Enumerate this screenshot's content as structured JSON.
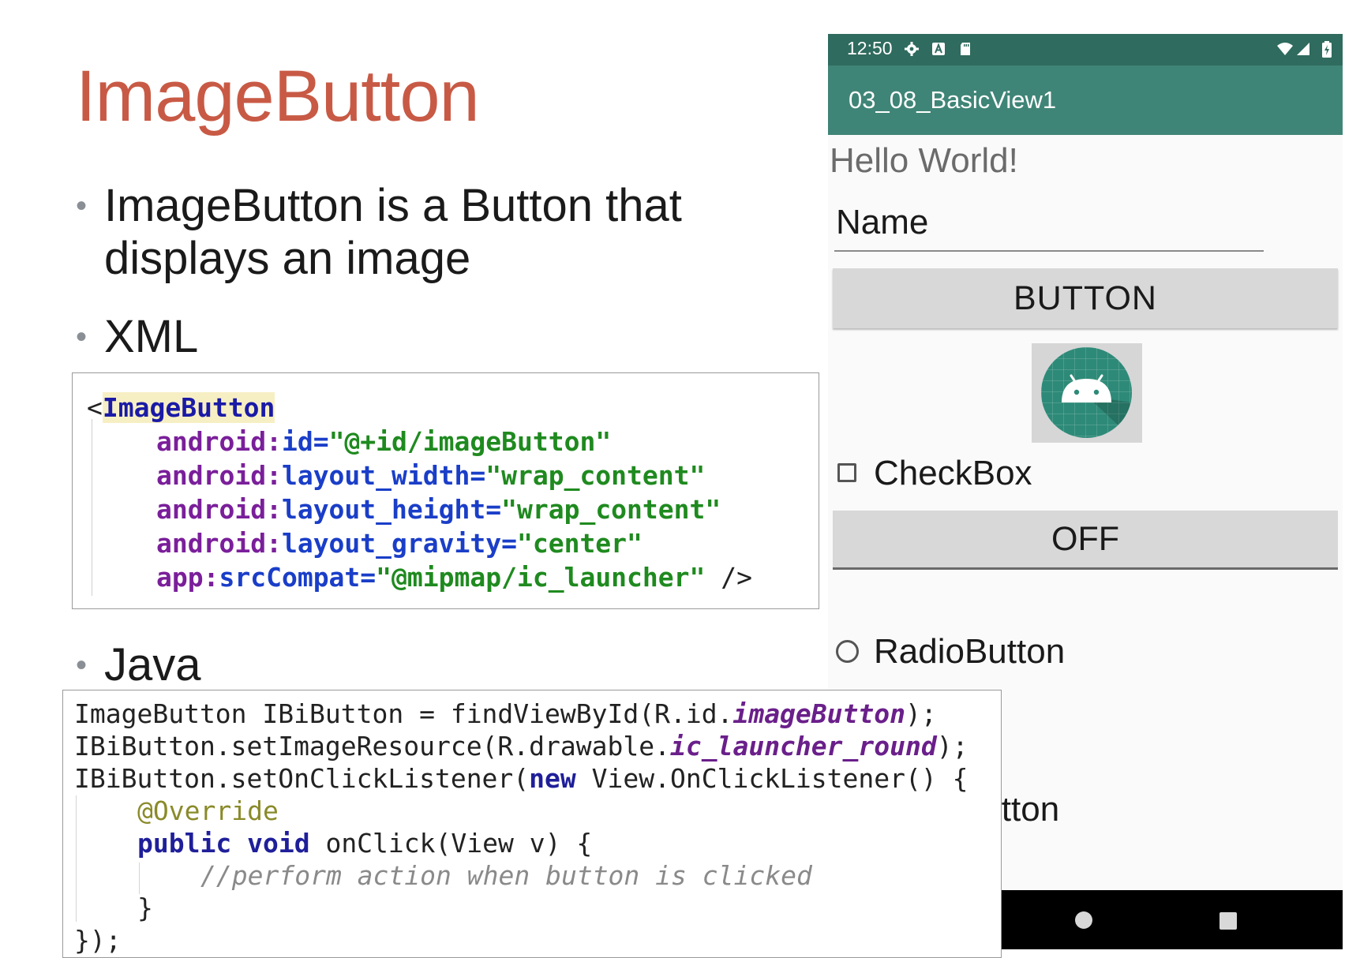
{
  "slide": {
    "title": "ImageButton",
    "bullets": {
      "b1_line1": "ImageButton is a Button that",
      "b1_line2": "displays an image",
      "b2": "XML",
      "b3": "Java",
      "marker": "•"
    }
  },
  "xml_code": {
    "open": "<",
    "tag": "ImageButton",
    "lines": [
      {
        "ns": "android:",
        "name": "id=",
        "value": "\"@+id/imageButton\"",
        "tail": ""
      },
      {
        "ns": "android:",
        "name": "layout_width=",
        "value": "\"wrap_content\"",
        "tail": ""
      },
      {
        "ns": "android:",
        "name": "layout_height=",
        "value": "\"wrap_content\"",
        "tail": ""
      },
      {
        "ns": "android:",
        "name": "layout_gravity=",
        "value": "\"center\"",
        "tail": ""
      },
      {
        "ns": "app:",
        "name": "srcCompat=",
        "value": "\"@mipmap/ic_launcher\"",
        "tail": " />"
      }
    ]
  },
  "java_code": {
    "l1_a": "ImageButton IBiButton = findViewById(R.id.",
    "l1_b": "imageButton",
    "l1_c": ");",
    "l2_a": "IBiButton.setImageResource(R.drawable.",
    "l2_b": "ic_launcher_round",
    "l2_c": ");",
    "l3_a": "IBiButton.setOnClickListener(",
    "l3_kw": "new",
    "l3_c": " View.OnClickListener() {",
    "l4": "@Override",
    "l5_kw1": "public",
    "l5_kw2": "void",
    "l5_c": " onClick(View v) {",
    "l6": "//perform action when button is clicked",
    "l7": "}",
    "l8": "});"
  },
  "phone": {
    "status_time": "12:50",
    "status_icons_left": [
      "settings-icon",
      "a-icon",
      "sd-card-icon"
    ],
    "status_icons_right": [
      "wifi-icon",
      "signal-icon",
      "battery-icon"
    ],
    "app_title": "03_08_BasicView1",
    "hello": "Hello World!",
    "name_hint": "Name",
    "button_label": "BUTTON",
    "image_button_icon": "android-launcher-icon",
    "checkbox_label": "CheckBox",
    "checkbox_checked": false,
    "toggle_label": "OFF",
    "radio_label": "RadioButton",
    "radio_checked": false,
    "partial_text": "itton",
    "nav_icons": [
      "home-icon",
      "recents-icon"
    ],
    "colors": {
      "statusbar": "#2f6b5e",
      "appbar": "#3f8577",
      "launcher": "#2e8a78"
    }
  }
}
